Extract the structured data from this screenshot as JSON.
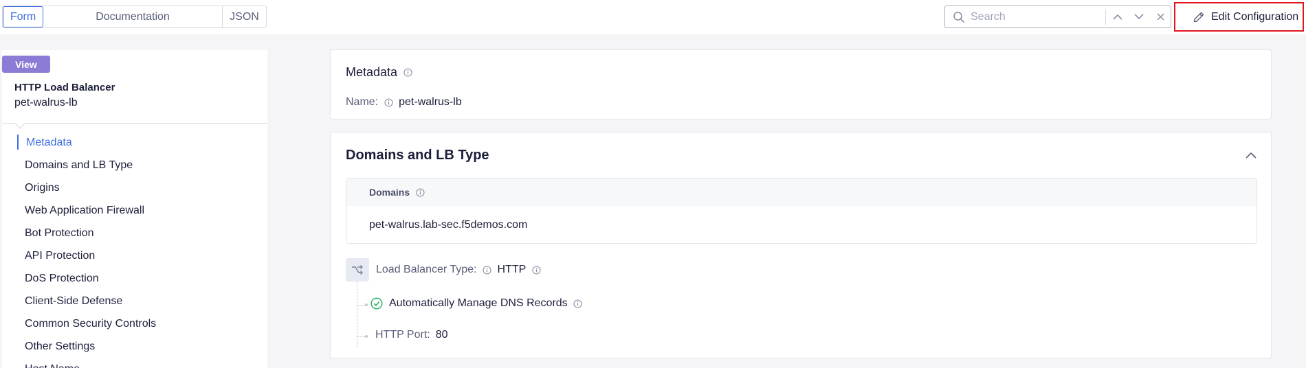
{
  "view_tabs": {
    "form": "Form",
    "documentation": "Documentation",
    "json": "JSON",
    "active": "Form"
  },
  "search": {
    "placeholder": "Search",
    "value": ""
  },
  "edit_button": {
    "label": "Edit Configuration"
  },
  "sidebar": {
    "badge": "View",
    "object_type": "HTTP Load Balancer",
    "object_name": "pet-walrus-lb",
    "items": [
      {
        "label": "Metadata",
        "active": true
      },
      {
        "label": "Domains and LB Type"
      },
      {
        "label": "Origins"
      },
      {
        "label": "Web Application Firewall"
      },
      {
        "label": "Bot Protection"
      },
      {
        "label": "API Protection"
      },
      {
        "label": "DoS Protection"
      },
      {
        "label": "Client-Side Defense"
      },
      {
        "label": "Common Security Controls"
      },
      {
        "label": "Other Settings"
      },
      {
        "label": "Host Name"
      }
    ]
  },
  "metadata_card": {
    "title": "Metadata",
    "name_label": "Name:",
    "name_value": "pet-walrus-lb"
  },
  "domains_card": {
    "title": "Domains and LB Type",
    "domains_header": "Domains",
    "domains": [
      "pet-walrus.lab-sec.f5demos.com"
    ],
    "lb_type_label": "Load Balancer Type:",
    "lb_type_value": "HTTP",
    "dns_label": "Automatically Manage DNS Records",
    "http_port_label": "HTTP Port:",
    "http_port_value": "80"
  },
  "colors": {
    "accent": "#3f6fe0",
    "view_badge": "#8d7bd6",
    "edit_highlight": "#e0151b",
    "success": "#2fb36a"
  },
  "icons": [
    "search-icon",
    "chevron-up-icon",
    "chevron-down-icon",
    "close-icon",
    "pencil-icon",
    "info-icon",
    "collapse-chevron-icon",
    "routing-icon",
    "check-circle-icon"
  ]
}
